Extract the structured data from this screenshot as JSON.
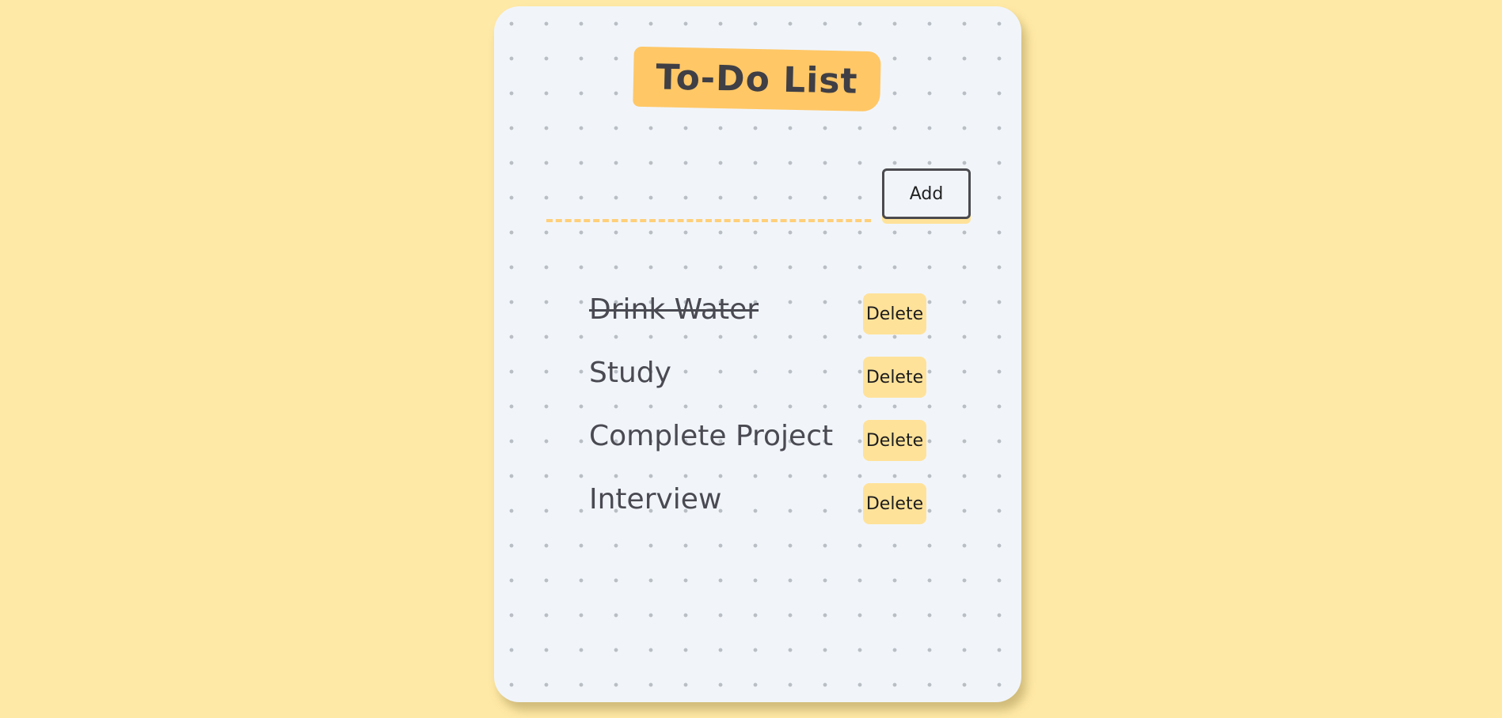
{
  "app": {
    "title": "To-Do List"
  },
  "input": {
    "value": "",
    "placeholder": ""
  },
  "add_button": {
    "label": "Add"
  },
  "tasks": [
    {
      "text": "Drink Water",
      "completed": true,
      "delete_label": "Delete"
    },
    {
      "text": "Study",
      "completed": false,
      "delete_label": "Delete"
    },
    {
      "text": "Complete Project",
      "completed": false,
      "delete_label": "Delete"
    },
    {
      "text": "Interview",
      "completed": false,
      "delete_label": "Delete"
    }
  ],
  "colors": {
    "page_background": "#ffe9a6",
    "card_background": "#f1f5fa",
    "title_highlight": "#ffc766",
    "button_background": "#ffe29a",
    "text": "#4a4a52"
  }
}
